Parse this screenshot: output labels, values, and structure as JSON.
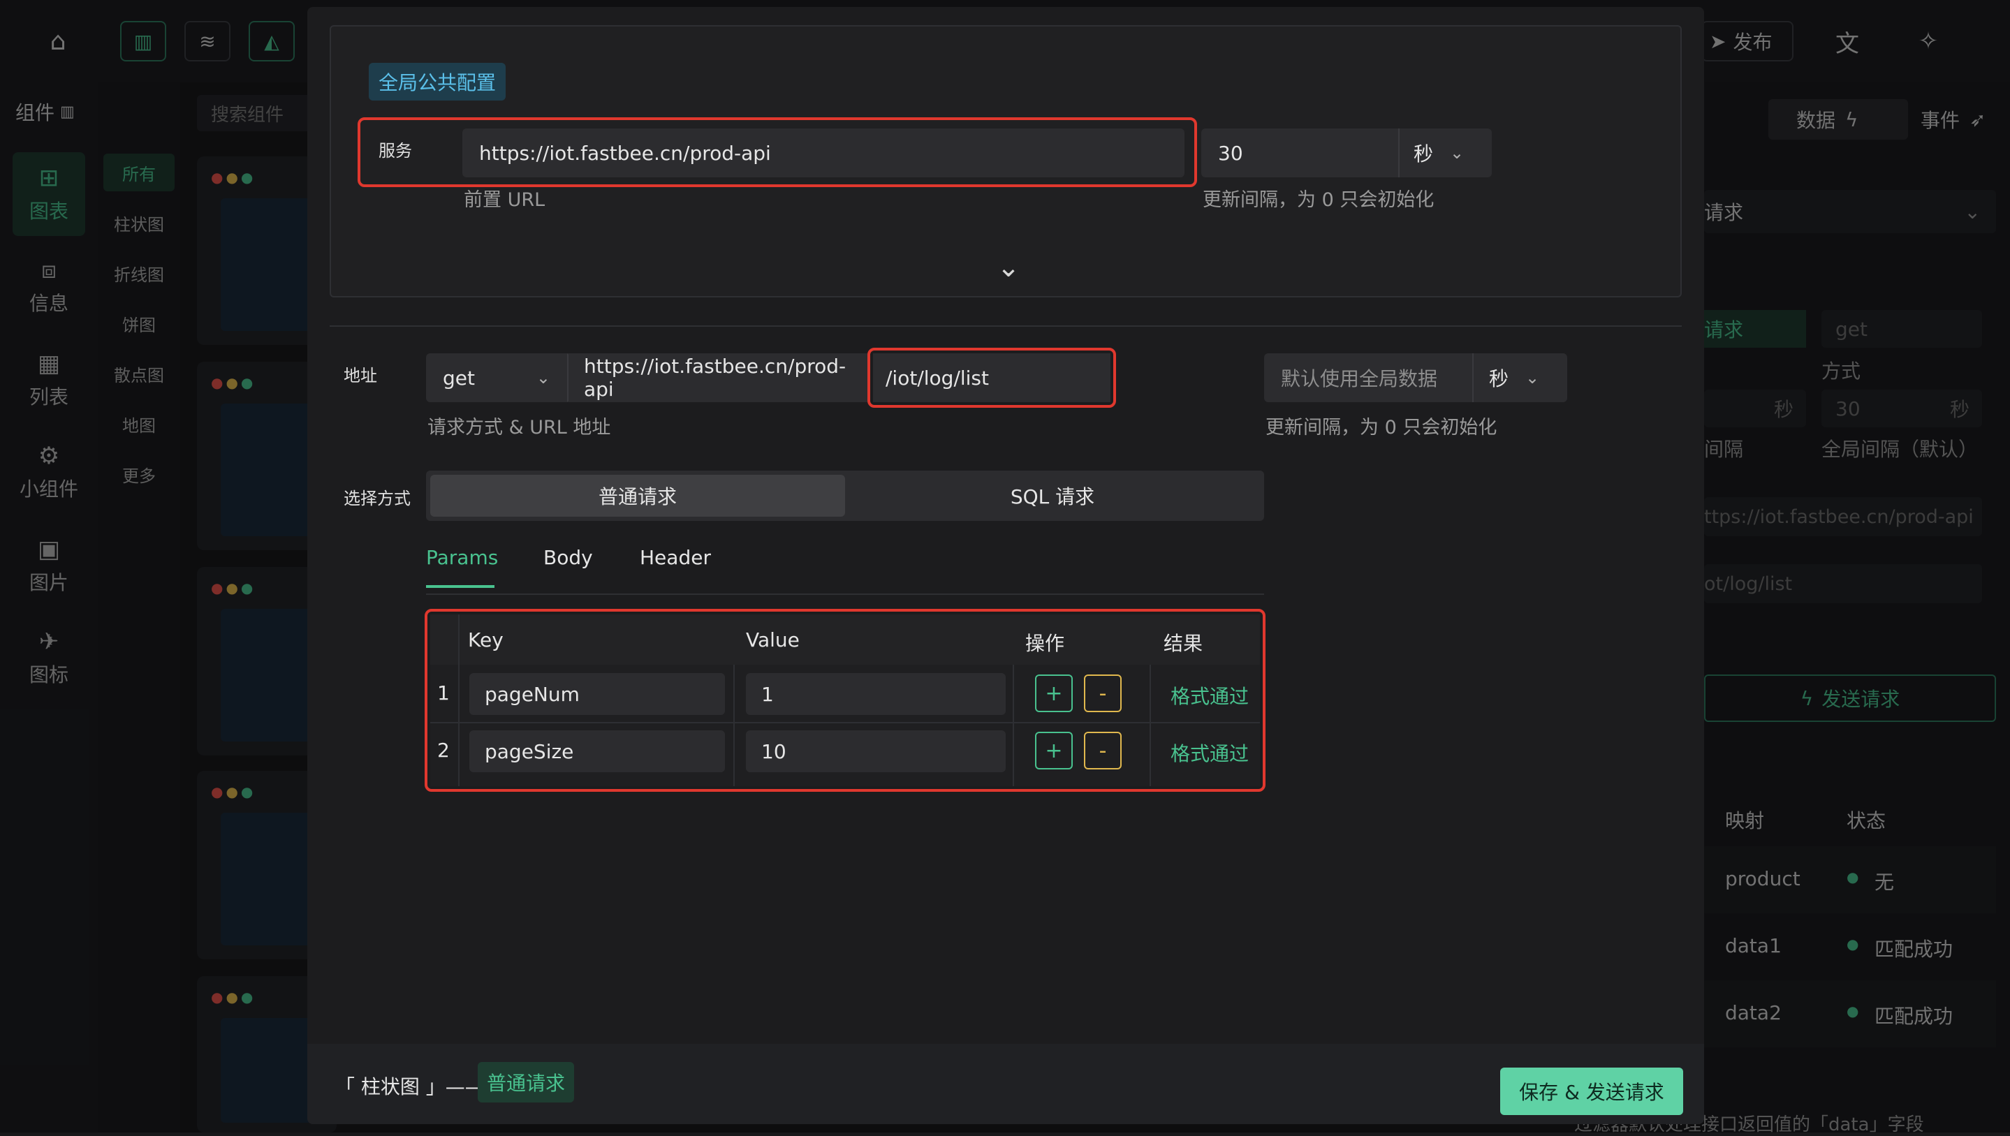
{
  "background": {
    "topbar": {
      "publish": "发布"
    },
    "sidebar": [
      {
        "icon": "chart-tree-icon",
        "label": "图表"
      },
      {
        "icon": "info-icon",
        "label": "信息"
      },
      {
        "icon": "table-icon",
        "label": "列表"
      },
      {
        "icon": "widget-icon",
        "label": "小组件"
      },
      {
        "icon": "image-icon",
        "label": "图片"
      },
      {
        "icon": "plane-icon",
        "label": "图标"
      }
    ],
    "components_title": "组件",
    "search_placeholder": "搜索组件",
    "categories": [
      "所有",
      "柱状图",
      "折线图",
      "饼图",
      "散点图",
      "地图",
      "更多"
    ],
    "right_panel": {
      "tabs": {
        "data": "数据",
        "event": "事件"
      },
      "select_suffix": "请求",
      "req_label_fragment": "请求",
      "method_value": "get",
      "method_hint": "方式",
      "interval_unit": "秒",
      "interval_hint_fragment": "间隔",
      "global_value": "30",
      "global_unit": "秒",
      "global_hint": "全局间隔（默认）",
      "url_fragment": "ttps://iot.fastbee.cn/prod-api",
      "path_fragment": "ot/log/list",
      "send_button": "发送请求",
      "table_headers": {
        "mapping": "映射",
        "status": "状态"
      },
      "rows": [
        {
          "mapping": "product",
          "status": "无"
        },
        {
          "mapping": "data1",
          "status": "匹配成功"
        },
        {
          "mapping": "data2",
          "status": "匹配成功"
        }
      ],
      "bottom_note": "过滤器默认处理接口返回值的「data」字段"
    }
  },
  "modal": {
    "global": {
      "tag": "全局公共配置",
      "service_label": "服务",
      "service_url": "https://iot.fastbee.cn/prod-api",
      "service_hint": "前置 URL",
      "interval_value": "30",
      "interval_unit": "秒",
      "interval_hint": "更新间隔，为 0 只会初始化"
    },
    "address": {
      "label": "地址",
      "method": "get",
      "base_url": "https://iot.fastbee.cn/prod-api",
      "path": "/iot/log/list",
      "hint": "请求方式 & URL 地址",
      "interval_placeholder": "默认使用全局数据",
      "interval_unit": "秒",
      "interval_hint": "更新间隔，为 0 只会初始化"
    },
    "mode": {
      "label": "选择方式",
      "normal": "普通请求",
      "sql": "SQL 请求"
    },
    "tabs": [
      "Params",
      "Body",
      "Header"
    ],
    "params": {
      "headers": {
        "key": "Key",
        "value": "Value",
        "op": "操作",
        "result": "结果"
      },
      "plus": "+",
      "minus": "-",
      "rows": [
        {
          "index": "1",
          "key": "pageNum",
          "value": "1",
          "result": "格式通过"
        },
        {
          "index": "2",
          "key": "pageSize",
          "value": "10",
          "result": "格式通过"
        }
      ]
    },
    "footer": {
      "title": "「 柱状图 」——",
      "tag": "普通请求",
      "save_button": "保存 & 发送请求"
    }
  }
}
